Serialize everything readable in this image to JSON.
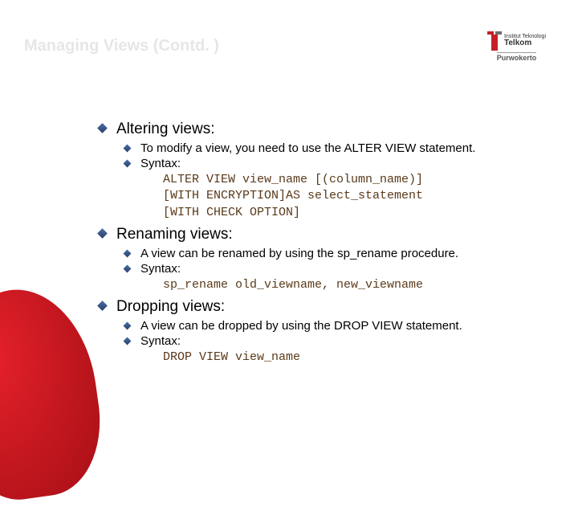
{
  "title": "Managing Views (Contd. )",
  "logo": {
    "line1": "Institut Teknologi",
    "line2": "Telkom",
    "sub": "Purwokerto"
  },
  "sections": [
    {
      "heading": "Altering views:",
      "bullets": [
        "To modify a view, you need to use the ALTER VIEW statement.",
        "Syntax:"
      ],
      "code": "ALTER VIEW view_name [(column_name)]\n[WITH ENCRYPTION]AS select_statement\n[WITH CHECK OPTION]"
    },
    {
      "heading": "Renaming views:",
      "bullets": [
        "A view can be renamed by using the sp_rename procedure.",
        "Syntax:"
      ],
      "code": "sp_rename old_viewname, new_viewname"
    },
    {
      "heading": "Dropping views:",
      "bullets": [
        "A view can be dropped by using the DROP VIEW statement.",
        "Syntax:"
      ],
      "code": "DROP VIEW view_name"
    }
  ]
}
